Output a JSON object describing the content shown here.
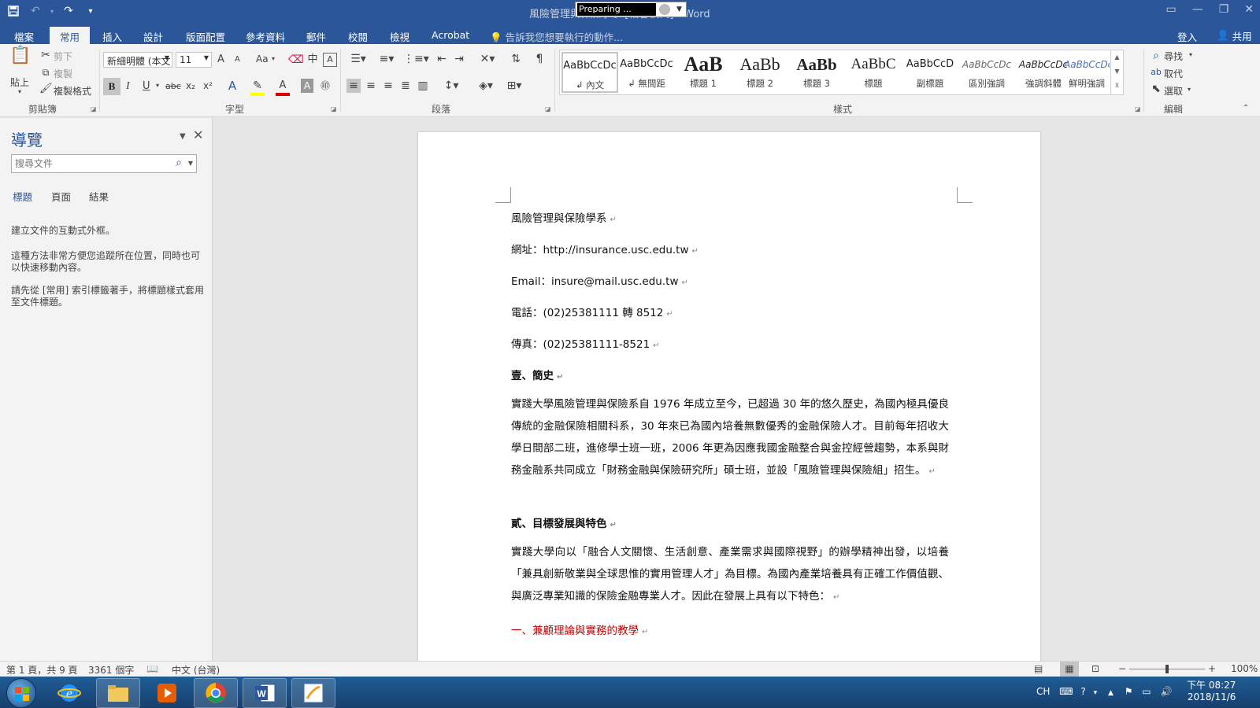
{
  "titlebar": {
    "doc_title": "風險管理與保險學系  [相容模式] - Word",
    "preparing_text": "Preparing ...",
    "qat_icons": [
      "save-icon",
      "undo-icon",
      "redo-icon",
      "customize-icon"
    ],
    "window_icons": [
      "ribbon-display-icon",
      "minimize-icon",
      "restore-icon",
      "close-icon"
    ]
  },
  "tabs": {
    "file": "檔案",
    "home": "常用",
    "insert": "插入",
    "design": "設計",
    "layout": "版面配置",
    "references": "參考資料",
    "mailings": "郵件",
    "review": "校閱",
    "view": "檢視",
    "acrobat": "Acrobat",
    "tell_me": "告訴我您想要執行的動作...",
    "sign_in": "登入",
    "share": "共用"
  },
  "ribbon": {
    "clipboard": {
      "paste": "貼上",
      "cut": "剪下",
      "copy": "複製",
      "format_painter": "複製格式",
      "label": "剪貼簿"
    },
    "font": {
      "font_name": "新細明體 (本文",
      "font_size": "11",
      "grow": "A",
      "shrink": "A",
      "change_case": "Aa",
      "bold": "B",
      "italic": "I",
      "underline": "U",
      "strike": "abc",
      "subscript": "x₂",
      "superscript": "x²",
      "label": "字型"
    },
    "paragraph": {
      "label": "段落"
    },
    "styles": {
      "items": [
        {
          "sample": "AaBbCcDc",
          "name": "↲ 內文"
        },
        {
          "sample": "AaBbCcDc",
          "name": "↲ 無間距"
        },
        {
          "sample": "AaB",
          "name": "標題 1"
        },
        {
          "sample": "AaBb",
          "name": "標題 2"
        },
        {
          "sample": "AaBb",
          "name": "標題 3"
        },
        {
          "sample": "AaBbC",
          "name": "標題"
        },
        {
          "sample": "AaBbCcD",
          "name": "副標題"
        },
        {
          "sample": "AaBbCcDc",
          "name": "區別強調"
        },
        {
          "sample": "AaBbCcDc",
          "name": "強調斜體"
        },
        {
          "sample": "AaBbCcDc",
          "name": "鮮明強調"
        }
      ],
      "label": "樣式"
    },
    "editing": {
      "find": "尋找",
      "replace": "取代",
      "select": "選取",
      "label": "編輯"
    }
  },
  "nav": {
    "title": "導覽",
    "search_placeholder": "搜尋文件",
    "tabs": [
      "標題",
      "頁面",
      "結果"
    ],
    "para1": "建立文件的互動式外框。",
    "para2": "這種方法非常方便您追蹤所在位置，同時也可以快速移動內容。",
    "para3": "請先從 [常用] 索引標籤著手，將標題樣式套用至文件標題。"
  },
  "document": {
    "line1": "風險管理與保險學系",
    "line2": "網址：http://insurance.usc.edu.tw",
    "line3": "Email：insure@mail.usc.edu.tw",
    "line4": "電話：(02)25381111 轉 8512",
    "line5": "傳真：(02)25381111-8521",
    "heading1": "壹、簡史",
    "para1": "實踐大學風險管理與保險系自 1976 年成立至今，已超過 30 年的悠久歷史，為國內極具優良傳統的金融保險相關科系，30 年來已為國內培養無數優秀的金融保險人才。目前每年招收大學日間部二班，進修學士班一班，2006 年更為因應我國金融整合與金控經營趨勢，本系與財務金融系共同成立「財務金融與保險研究所」碩士班，並設「風險管理與保險組」招生。",
    "heading2": "貳、目標發展與特色",
    "para2": "實踐大學向以「融合人文關懷、生活創意、產業需求與國際視野」的辦學精神出發，以培養「兼具創新敬業與全球思惟的實用管理人才」為目標。為國內產業培養具有正確工作價值觀、與廣泛專業知識的保險金融專業人才。因此在發展上具有以下特色：",
    "item1": "一、兼顧理論與實務的教學",
    "paragraph_mark": "↵"
  },
  "statusbar": {
    "page": "第 1 頁，共 9 頁",
    "words": "3361 個字",
    "language": "中文 (台灣)",
    "zoom": "100%",
    "zoom_percent": 100
  },
  "taskbar": {
    "apps": [
      "ie-icon",
      "explorer-icon",
      "media-player-icon",
      "chrome-icon",
      "word-icon",
      "pen-app-icon"
    ],
    "tray_lang": "CH",
    "time": "下午 08:27",
    "date": "2018/11/6"
  },
  "colors": {
    "word_blue": "#2b579a",
    "ribbon_bg": "#f3f3f3",
    "red_text": "#c00000"
  }
}
